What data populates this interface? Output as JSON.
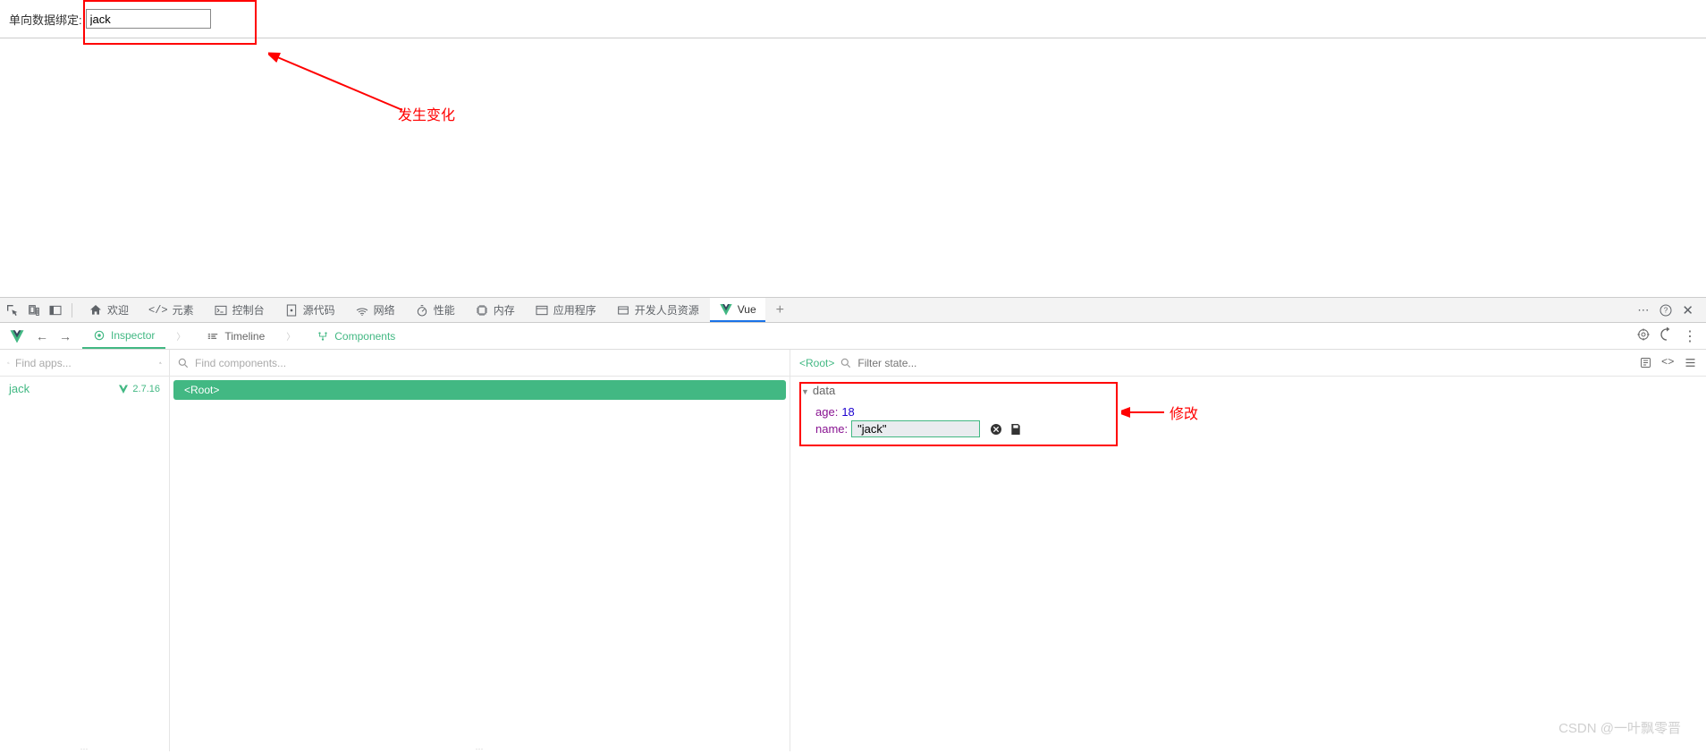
{
  "page": {
    "label": "单向数据绑定:",
    "input_value": "jack"
  },
  "annotations": {
    "anno1": "发生变化",
    "anno2": "修改"
  },
  "devtools": {
    "tabs": {
      "welcome": "欢迎",
      "elements": "元素",
      "console": "控制台",
      "sources": "源代码",
      "network": "网络",
      "performance": "性能",
      "memory": "内存",
      "application": "应用程序",
      "devres": "开发人员资源",
      "vue": "Vue"
    }
  },
  "vuebar": {
    "inspector": "Inspector",
    "timeline": "Timeline",
    "components": "Components"
  },
  "left_panel": {
    "search_placeholder": "Find apps...",
    "app_name": "jack",
    "version": "2.7.16"
  },
  "mid_panel": {
    "search_placeholder": "Find components...",
    "root": "<Root>"
  },
  "right_panel": {
    "root_tag": "<Root>",
    "filter_placeholder": "Filter state...",
    "data_label": "data",
    "props": {
      "age_key": "age:",
      "age_val": "18",
      "name_key": "name:",
      "name_val": "\"jack\""
    }
  },
  "watermark": "CSDN @一叶飘零晋"
}
